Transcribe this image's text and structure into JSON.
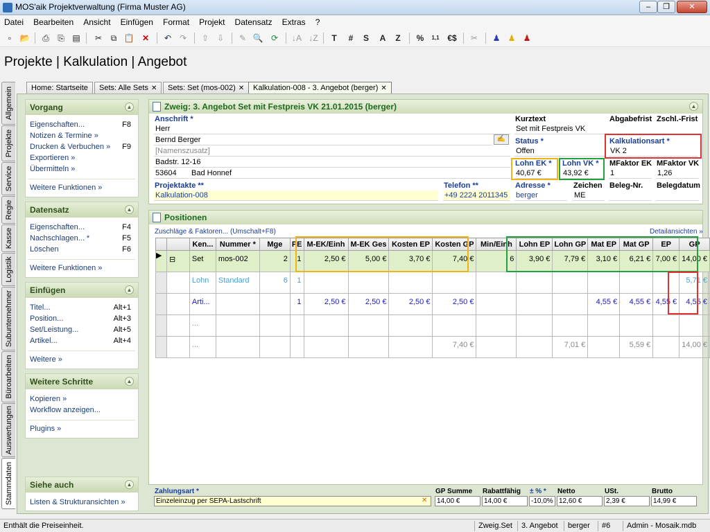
{
  "window": {
    "title": "MOS'aik Projektverwaltung (Firma Muster AG)"
  },
  "menu": [
    "Datei",
    "Bearbeiten",
    "Ansicht",
    "Einfügen",
    "Format",
    "Projekt",
    "Datensatz",
    "Extras",
    "?"
  ],
  "breadcrumb": "Projekte | Kalkulation | Angebot",
  "vtabs": [
    "Allgemein",
    "Projekte",
    "Service",
    "Regie",
    "Kasse",
    "Logistik",
    "Subunternehmer",
    "Büroarbeiten",
    "Auswertungen",
    "Stammdaten"
  ],
  "doc_tabs": [
    "Home: Startseite",
    "Sets: Alle Sets",
    "Sets: Set (mos-002)",
    "Kalkulation-008 - 3. Angebot (berger)"
  ],
  "sidebar": {
    "vorgang": {
      "title": "Vorgang",
      "items": [
        {
          "label": "Eigenschaften...",
          "key": "F8"
        },
        {
          "label": "Notizen & Termine »",
          "key": ""
        },
        {
          "label": "Drucken & Verbuchen »",
          "key": "F9"
        },
        {
          "label": "Exportieren »",
          "key": ""
        },
        {
          "label": "Übermitteln »",
          "key": ""
        }
      ],
      "more": "Weitere Funktionen »"
    },
    "datensatz": {
      "title": "Datensatz",
      "items": [
        {
          "label": "Eigenschaften...",
          "key": "F4"
        },
        {
          "label": "Nachschlagen... *",
          "key": "F5"
        },
        {
          "label": "Löschen",
          "key": "F6"
        }
      ],
      "more": "Weitere Funktionen »"
    },
    "einfuegen": {
      "title": "Einfügen",
      "items": [
        {
          "label": "Titel...",
          "key": "Alt+1"
        },
        {
          "label": "Position...",
          "key": "Alt+3"
        },
        {
          "label": "Set/Leistung...",
          "key": "Alt+5"
        },
        {
          "label": "Artikel...",
          "key": "Alt+4"
        }
      ],
      "more": "Weitere »"
    },
    "schritte": {
      "title": "Weitere Schritte",
      "items": [
        {
          "label": "Kopieren »",
          "key": ""
        },
        {
          "label": "Workflow anzeigen...",
          "key": ""
        }
      ],
      "more": "Plugins »"
    },
    "siehe": {
      "title": "Siehe auch",
      "items": [
        {
          "label": "Listen & Strukturansichten »",
          "key": ""
        }
      ]
    }
  },
  "zweig": {
    "title": "Zweig: 3. Angebot Set mit Festpreis VK 21.01.2015 (berger)",
    "anschrift_label": "Anschrift *",
    "anrede": "Herr",
    "name": "Bernd Berger",
    "namenszusatz": "[Namenszusatz]",
    "strasse": "Badstr. 12-16",
    "plz": "53604",
    "ort": "Bad Honnef",
    "projektakte_label": "Projektakte **",
    "projektakte": "Kalkulation-008",
    "telefon_label": "Telefon **",
    "telefon": "+49 2224 2011345",
    "kurztext_label": "Kurztext",
    "kurztext": "Set mit Festpreis VK",
    "abgabefrist_label": "Abgabefrist",
    "zschl_label": "Zschl.-Frist",
    "status_label": "Status *",
    "status": "Offen",
    "kalkart_label": "Kalkulationsart *",
    "kalkart": "VK 2",
    "lohnek_label": "Lohn EK *",
    "lohnek": "40,67 €",
    "lohnvk_label": "Lohn VK *",
    "lohnvk": "43,92 €",
    "mfek_label": "MFaktor EK",
    "mfek": "1",
    "mfvk_label": "MFaktor VK",
    "mfvk": "1,26",
    "adresse_label": "Adresse *",
    "adresse": "berger",
    "zeichen_label": "Zeichen",
    "zeichen": "ME",
    "belegnr_label": "Beleg-Nr.",
    "belegdatum_label": "Belegdatum"
  },
  "positionen": {
    "title": "Positionen",
    "zuschlaege": "Zuschläge & Faktoren... (Umschalt+F8)",
    "details": "Detailansichten »",
    "columns": [
      "",
      "",
      "Ken...",
      "Nummer *",
      "Mge",
      "PE",
      "M-EK/Einh",
      "M-EK Ges",
      "Kosten EP",
      "Kosten GP",
      "Min/Einh",
      "Lohn EP",
      "Lohn GP",
      "Mat EP",
      "Mat GP",
      "EP",
      "GP"
    ],
    "rows": [
      {
        "cells": [
          "▶",
          "⊟",
          "Set",
          "mos-002",
          "2",
          "1",
          "2,50 €",
          "5,00 €",
          "3,70 €",
          "7,40 €",
          "6",
          "3,90 €",
          "7,79 €",
          "3,10 €",
          "6,21 €",
          "7,00 €",
          "14,00 €"
        ]
      },
      {
        "cells": [
          "",
          "",
          "Lohn",
          "Standard",
          "6",
          "1",
          "",
          "",
          "",
          "",
          "",
          "",
          "",
          "",
          "",
          "",
          "5,71 €"
        ]
      },
      {
        "cells": [
          "",
          "",
          "Arti...",
          "",
          "",
          "1",
          "2,50 €",
          "2,50 €",
          "2,50 €",
          "2,50 €",
          "",
          "",
          "",
          "4,55 €",
          "4,55 €",
          "4,55 €",
          "4,55 €"
        ]
      },
      {
        "cells": [
          "",
          "",
          "...",
          "",
          "",
          "",
          "",
          "",
          "",
          "",
          "",
          "",
          "",
          "",
          "",
          "",
          ""
        ]
      },
      {
        "cells": [
          "",
          "",
          "...",
          "",
          "",
          "",
          "",
          "",
          "",
          "7,40 €",
          "",
          "",
          "7,01 €",
          "",
          "5,59 €",
          "",
          "14,00 €"
        ]
      }
    ]
  },
  "zahlung": {
    "label": "Zahlungsart *",
    "value": "Einzeleinzug per SEPA-Lastschrift",
    "gpsumme_label": "GP Summe",
    "gpsumme": "14,00 €",
    "rabatt_label": "Rabattfähig",
    "rabatt": "14,00 €",
    "pct_label": "± % *",
    "pct": "-10,0%",
    "netto_label": "Netto",
    "netto": "12,60 €",
    "ust_label": "USt.",
    "ust": "2,39 €",
    "brutto_label": "Brutto",
    "brutto": "14,99 €"
  },
  "statusbar": {
    "message": "Enthält die Preiseinheit.",
    "zweig": "Zweig.Set",
    "angebot": "3. Angebot",
    "user": "berger",
    "num": "#6",
    "db": "Admin - Mosaik.mdb"
  }
}
